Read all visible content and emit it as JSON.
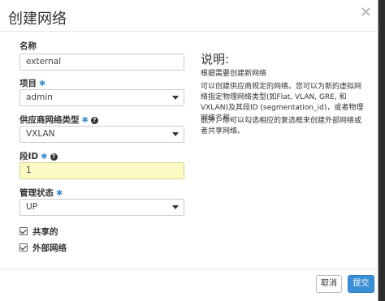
{
  "dialog": {
    "title": "创建网络",
    "close_label": "×"
  },
  "form": {
    "name": {
      "label": "名称",
      "value": "external"
    },
    "project": {
      "label": "项目",
      "value": "admin"
    },
    "provider_network_type": {
      "label": "供应商网络类型",
      "value": "VXLAN"
    },
    "segment_id": {
      "label": "段ID",
      "value": "1"
    },
    "admin_state": {
      "label": "管理状态",
      "value": "UP"
    },
    "shared": {
      "label": "共享的",
      "checked": true
    },
    "external_network": {
      "label": "外部网络",
      "checked": true
    }
  },
  "description": {
    "title": "说明:",
    "line1": "根据需要创建新网络",
    "para2": "可以创建供应商规定的网络。您可以为新的虚拟网络指定物理网络类型(如Flat, VLAN, GRE, 和 VXLAN)及其段ID (segmentation_id)，或者物理网络名称。",
    "para3": "此外，你可以勾选相应的复选框来创建外部网络或者共享网络。"
  },
  "buttons": {
    "cancel": "取消",
    "submit": "提交"
  },
  "colors": {
    "accent": "#3b8fd6",
    "highlight_field": "#fcfbc4"
  }
}
